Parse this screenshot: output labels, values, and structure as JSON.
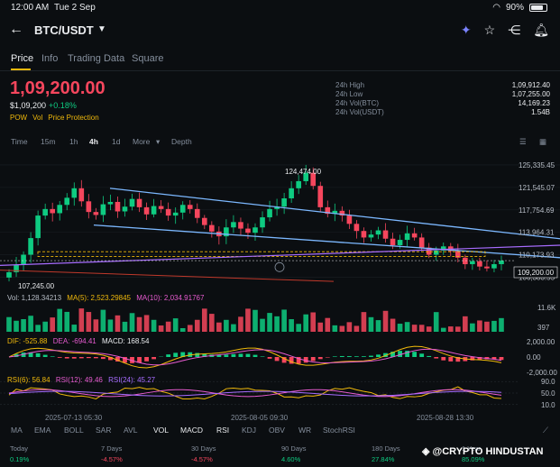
{
  "status": {
    "time": "12:00 AM",
    "date": "Tue 2 Sep",
    "battery": "90%"
  },
  "header": {
    "pair": "BTC/USDT"
  },
  "tabs": [
    "Price",
    "Info",
    "Trading Data",
    "Square"
  ],
  "price": {
    "last": "1,09,200.00",
    "usd": "$1,09,200",
    "change": "+0.18%"
  },
  "tags": [
    "POW",
    "Vol",
    "Price Protection"
  ],
  "stats": [
    {
      "k": "24h High",
      "v": "1,09,912.40"
    },
    {
      "k": "24h Low",
      "v": "1,07,255.00"
    },
    {
      "k": "24h Vol(BTC)",
      "v": "14,169.23"
    },
    {
      "k": "24h Vol(USDT)",
      "v": "1.54B"
    }
  ],
  "timeframes": [
    "Time",
    "15m",
    "1h",
    "4h",
    "1d",
    "More",
    "Depth"
  ],
  "active_timeframe": "4h",
  "chart_data": {
    "type": "candlestick",
    "price_axis": [
      "125,335.45",
      "121,545.07",
      "117,754.69",
      "113,964.31",
      "110,173.93",
      "106,383.55"
    ],
    "ylim": [
      104500,
      127000
    ],
    "current_price_label": "109,200.00",
    "high_label": "124,474.00",
    "low_label": "107,245.00",
    "volume_axis": [
      "11.6K",
      "397"
    ],
    "macd_axis": [
      "2,000.00",
      "0.00",
      "-2,000.00"
    ],
    "rsi_axis": [
      "90.0",
      "50.0",
      "10.0"
    ],
    "x_labels": [
      "2025-07-13 05:30",
      "2025-08-05 09:30",
      "2025-08-28 13:30"
    ],
    "vol_legend": {
      "vol": "Vol: 1,128.34213",
      "ma5": "MA(5): 2,523.29845",
      "ma10": "MA(10): 2,034.91767"
    },
    "macd_legend": {
      "dif": "DIF: -525.88",
      "dea": "DEA: -694.41",
      "macd": "MACD: 168.54"
    },
    "rsi_legend": {
      "r6": "RSI(6): 56.84",
      "r12": "RSI(12): 49.46",
      "r24": "RSI(24): 45.27"
    },
    "closes": [
      107245,
      108500,
      110200,
      113000,
      116800,
      117900,
      117200,
      118600,
      119800,
      121400,
      119200,
      117400,
      116900,
      118700,
      119100,
      117500,
      118300,
      119600,
      118200,
      117000,
      118400,
      117900,
      116800,
      117300,
      118600,
      117900,
      116400,
      115200,
      114100,
      113300,
      114800,
      115700,
      114600,
      113900,
      114800,
      116500,
      117900,
      118300,
      119700,
      121400,
      122600,
      124000,
      121800,
      118200,
      117100,
      117600,
      116800,
      115400,
      114200,
      113100,
      113600,
      114300,
      112900,
      111800,
      112700,
      113800,
      113100,
      111400,
      110200,
      110900,
      111600,
      110800,
      109700,
      108600,
      109100,
      108200,
      107900,
      108600,
      109200
    ],
    "colors": {
      "up": "#0ecb81",
      "down": "#f6465d",
      "trend": "#7cb8ff",
      "band": "#f0b90b",
      "ma1": "#f0b90b",
      "ma2": "#e75bd0"
    }
  },
  "indicators": [
    "MA",
    "EMA",
    "BOLL",
    "SAR",
    "AVL",
    "VOL",
    "MACD",
    "RSI",
    "KDJ",
    "OBV",
    "WR",
    "StochRSI"
  ],
  "active_indicators": [
    "VOL",
    "MACD",
    "RSI"
  ],
  "performance": [
    {
      "label": "Today",
      "value": "0.19%",
      "dir": "pos"
    },
    {
      "label": "7 Days",
      "value": "-4.57%",
      "dir": "neg"
    },
    {
      "label": "30 Days",
      "value": "-4.57%",
      "dir": "neg"
    },
    {
      "label": "90 Days",
      "value": "4.60%",
      "dir": "pos"
    },
    {
      "label": "180 Days",
      "value": "27.84%",
      "dir": "pos"
    },
    {
      "label": "1 Year",
      "value": "85.09%",
      "dir": "pos"
    }
  ],
  "watermark": "@CRYPTO HINDUSTAN"
}
